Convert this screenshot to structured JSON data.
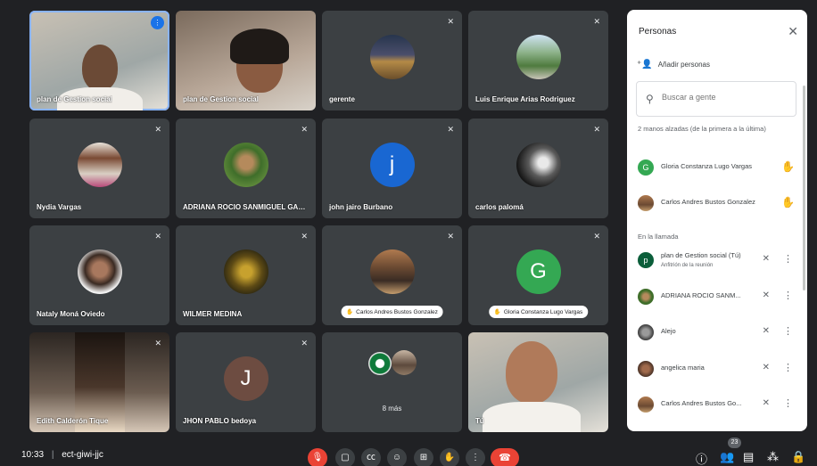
{
  "meeting": {
    "time": "10:33",
    "separator": "|",
    "code": "ect-giwi-jjc",
    "participant_count": "23"
  },
  "tiles": [
    {
      "name": "plan de Gestion social"
    },
    {
      "name": "plan de Gestion social"
    },
    {
      "name": "gerente"
    },
    {
      "name": "Luis Enrique Arias Rodriguez"
    },
    {
      "name": "Nydia Vargas"
    },
    {
      "name": "ADRIANA ROCIO SANMIGUEL GAL..."
    },
    {
      "name": "john jairo Burbano",
      "letter": "j"
    },
    {
      "name": "carlos palomá"
    },
    {
      "name": "Nataly Moná Oviedo"
    },
    {
      "name": "WILMER MEDINA"
    },
    {
      "name": "Carlos Andres Bustos Gonzalez"
    },
    {
      "name": "Gloria Constanza Lugo Vargas",
      "letter": "G"
    },
    {
      "name": "Edith Calderón Tique"
    },
    {
      "name": "JHON PABLO bedoya",
      "letter": "J"
    },
    {
      "name": "8 más"
    },
    {
      "name": "Tú"
    }
  ],
  "panel": {
    "title": "Personas",
    "add_label": "Añadir personas",
    "search_placeholder": "Buscar a gente",
    "raised_hands_header": "2 manos alzadas (de la primera a la última)",
    "raised": [
      {
        "name": "Gloria Constanza Lugo Vargas",
        "letter": "G"
      },
      {
        "name": "Carlos Andres Bustos Gonzalez"
      }
    ],
    "in_call_header": "En la llamada",
    "in_call": [
      {
        "name": "plan de Gestion social (Tú)",
        "sub": "Anfitrión de la reunión",
        "letter": "p"
      },
      {
        "name": "ADRIANA ROCIO SANM..."
      },
      {
        "name": "Alejo"
      },
      {
        "name": "angelica maria"
      },
      {
        "name": "Carlos Andres Bustos Go..."
      }
    ]
  },
  "colors": {
    "background": "#202124",
    "tile": "#3c4043",
    "accent": "#1a73e8",
    "end_call": "#ea4335",
    "avatar_j": "#1967d2",
    "avatar_G": "#34a853",
    "avatar_J": "#6d4c41",
    "avatar_p": "#0b5e3a"
  }
}
